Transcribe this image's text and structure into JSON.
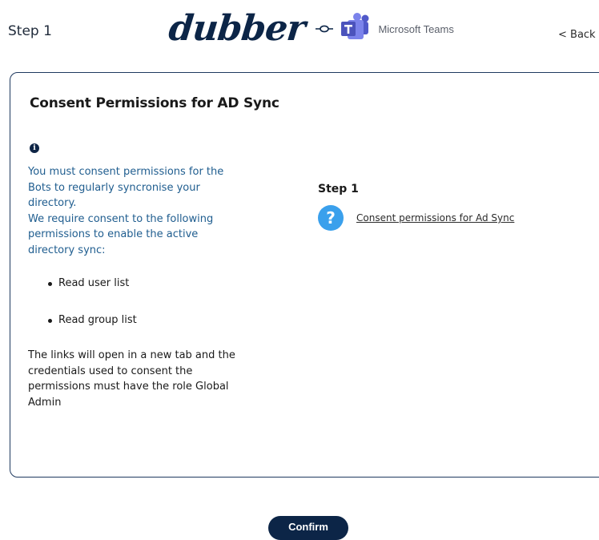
{
  "header": {
    "step_label": "Step 1",
    "brand": "dubber",
    "partner": "Microsoft Teams",
    "back_label": "< Back"
  },
  "card": {
    "title": "Consent Permissions for AD Sync",
    "intro_lines": [
      "You must consent permissions for the",
      "Bots to regularly syncronise your",
      "directory.",
      "We require consent to the following",
      "permissions to enable the active",
      "directory sync:"
    ],
    "permissions": [
      "Read user list",
      "Read group list"
    ],
    "note_lines": [
      "The links will open in a new tab and the",
      "credentials used to consent the",
      "permissions must have the role Global",
      "Admin"
    ],
    "step_heading": "Step 1",
    "consent_link": "Consent permissions for Ad Sync"
  },
  "footer": {
    "confirm_label": "Confirm"
  },
  "icons": {
    "info": "info-icon",
    "question": "question-icon",
    "link": "link-icon",
    "teams": "teams-logo"
  },
  "colors": {
    "brand_navy": "#0c2547",
    "info_text": "#1f5d8f",
    "help_blue": "#3aa0ec",
    "teams_purple": "#5059c9"
  }
}
